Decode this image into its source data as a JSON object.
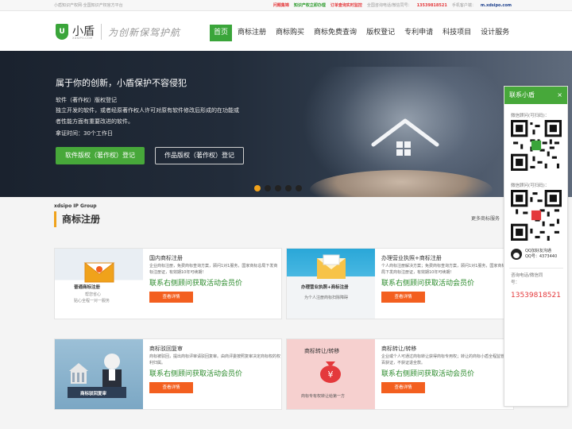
{
  "topbar": {
    "site_desc": "小盾知识产权网·全国知识产权官方平台",
    "link_issue": "问题集锦",
    "link_office": "知识产权立即办理",
    "link_monitor": "订单查询实时监控",
    "hotline_label": "全国咨询电话/微信同号：",
    "hotline": "13539818521",
    "mobile_label": "手机客户端：",
    "mobile_url": "m.xdsipo.com"
  },
  "header": {
    "logo_char": "U",
    "logo_name": "小盾",
    "logo_sub": "XDSIPO.COM",
    "slogan": "为创新保驾护航",
    "nav": [
      "首页",
      "商标注册",
      "商标购买",
      "商标免费查询",
      "版权登记",
      "专利申请",
      "科技项目",
      "设计服务"
    ]
  },
  "banner": {
    "title": "属于你的创新，小盾保护不容侵犯",
    "line1": "软件（著作权）版权登记",
    "line2": "独立开发的软件，或者经原著作权人许可对原有软件修改后形成的在功能或",
    "line3": "者性能方面有重要改进的软件。",
    "line4": "拿证时间：30个工作日",
    "btn1": "软件版权（著作权）登记",
    "btn2": "作品版权（著作权）登记"
  },
  "section": {
    "en": "xdsipo IP Group",
    "zh": "商标注册",
    "more": "更多商标服务"
  },
  "cards": [
    {
      "title": "国内商标注册",
      "desc": "企业商标注册，免费商标查询方案，顾问1对1服务，国家商标总局下发商标注册证，有效期10年可续期！",
      "cta": "联系右侧顾问获取活动会员价",
      "btn": "查看详情",
      "thumb_title": "普通商标注册",
      "thumb_sub1": "帮您省心",
      "thumb_sub2": "贴心全程一对一服务"
    },
    {
      "title": "办理营业执照+商标注册",
      "desc": "个人商标注册解决方案；免费商标查询方案，顾问1对1服务，国家商标总局下发商标注册证，有效期10年可续期！",
      "cta": "联系右侧顾问获取活动会员价",
      "btn": "查看详情",
      "thumb_title": "办理营业执照+商标注册",
      "thumb_sub1": "为个人注册商标扫除障碍"
    },
    {
      "title": "商标驳回复审",
      "desc": "商标被驳回，提出商标评审请驳回复审。由商评委按照复审决定商标权的权利归属。",
      "cta": "联系右侧顾问获取活动会员价",
      "btn": "查看详情",
      "thumb_title": "商标驳回复审"
    },
    {
      "title": "商标转让/转移",
      "desc": "企业或个人可通过商标转让获得商标专用权；转让的商标小盾全程监管百分百获证，不获证退全款。",
      "cta": "联系右侧顾问获取活动会员价",
      "btn": "查看详情",
      "thumb_title": "商标转让/转移",
      "thumb_sub1": "商标专有权转让给第一方"
    }
  ],
  "sidebar": {
    "title": "联系小盾",
    "close": "×",
    "wechat1": "微信顾问(可扫码)：",
    "wechat2": "微信顾问(可扫码)：",
    "qq_label": "QQ加好友沟通",
    "qq_num": "QQ号：4373440",
    "hotline_label1": "咨询电话/微信同",
    "hotline_label2": "号：",
    "hotline": "13539818521"
  },
  "colors": {
    "brand_green": "#3aa53a",
    "accent_orange": "#f35f1f",
    "accent_yellow": "#f0a21b",
    "alert_red": "#e4393c"
  }
}
